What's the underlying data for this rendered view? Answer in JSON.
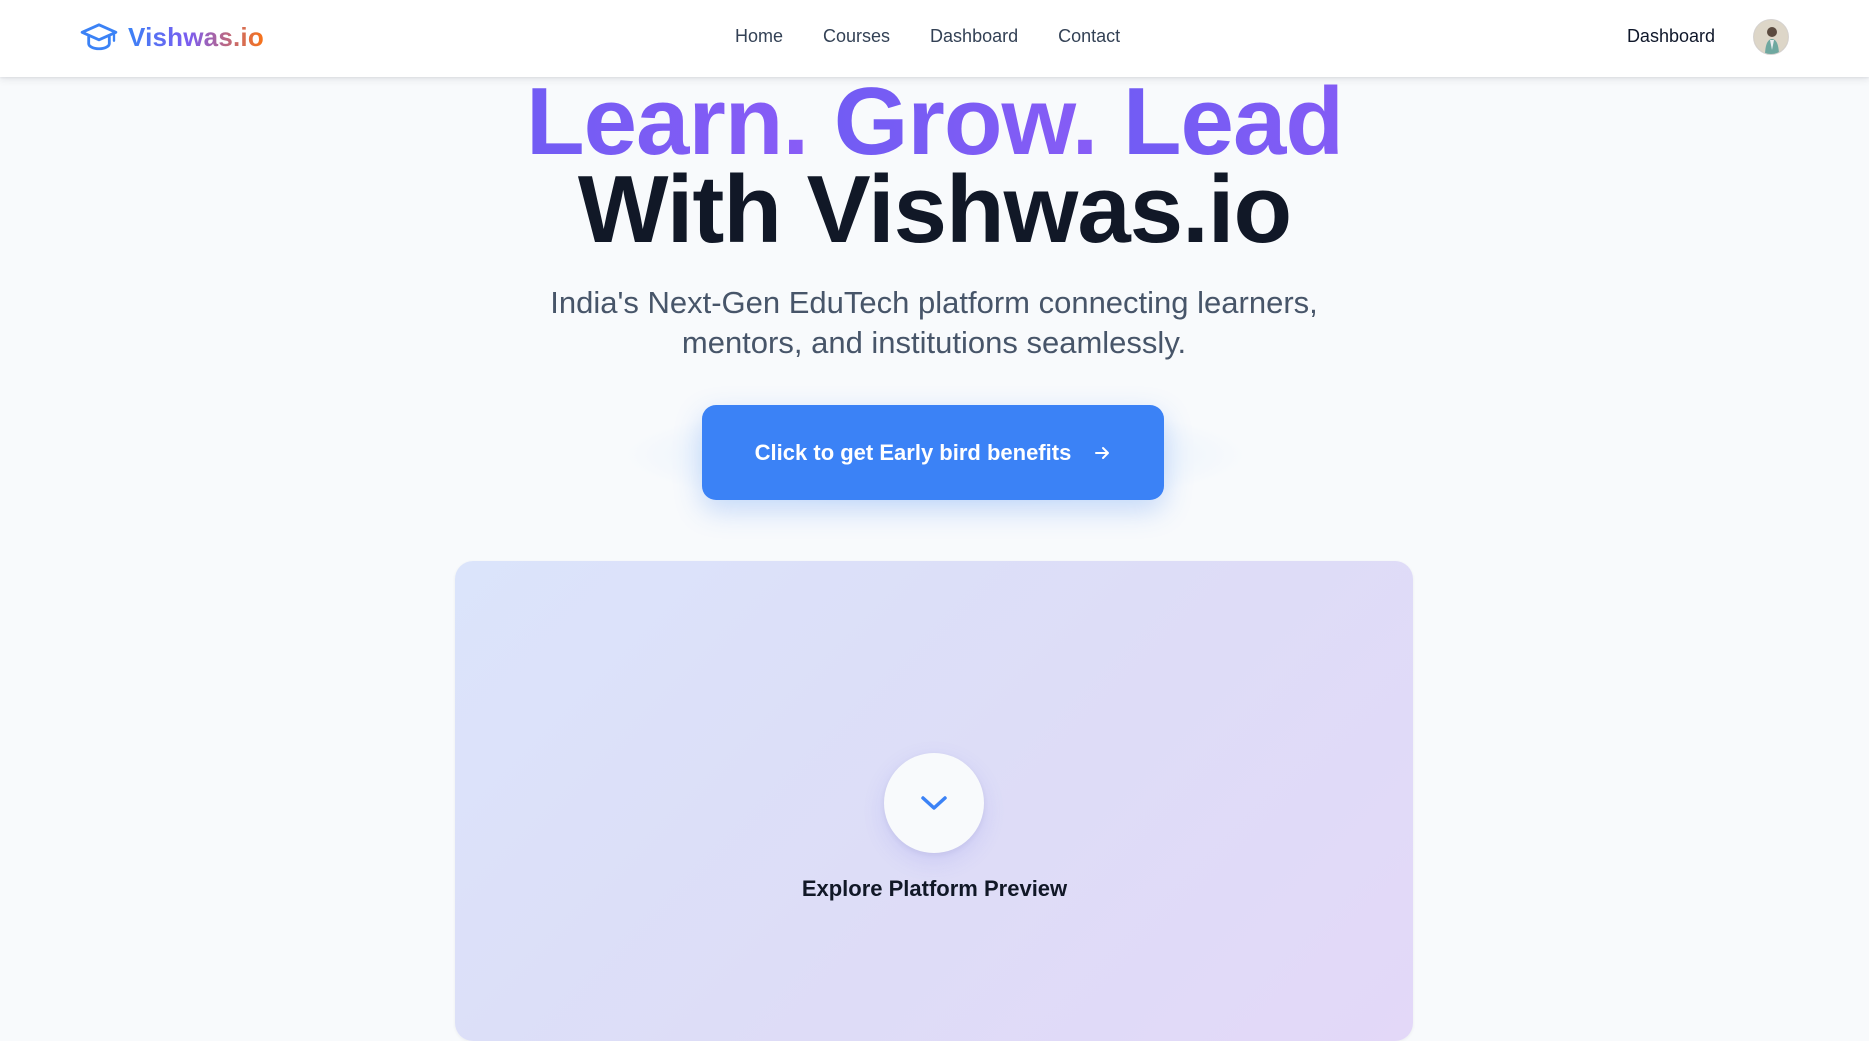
{
  "brand": {
    "name": "Vishwas.io",
    "icon": "graduation-cap-icon",
    "colors": [
      "#3b82f6",
      "#7c5cf0",
      "#f97316"
    ]
  },
  "nav": {
    "links": [
      "Home",
      "Courses",
      "Dashboard",
      "Contact"
    ],
    "dashboard_label": "Dashboard",
    "avatar": "user-avatar"
  },
  "hero": {
    "words": [
      "Learn.",
      "Grow.",
      "Lead"
    ],
    "line2": "With Vishwas.io",
    "subtitle_line1": "India's Next-Gen EduTech platform connecting learners,",
    "subtitle_line2": "mentors, and institutions seamlessly.",
    "cta_label": "Click to get Early bird benefits",
    "cta_icon": "arrow-right-icon",
    "accent": "#3b82f6"
  },
  "preview": {
    "icon": "chevron-down-icon",
    "label": "Explore Platform Preview"
  }
}
